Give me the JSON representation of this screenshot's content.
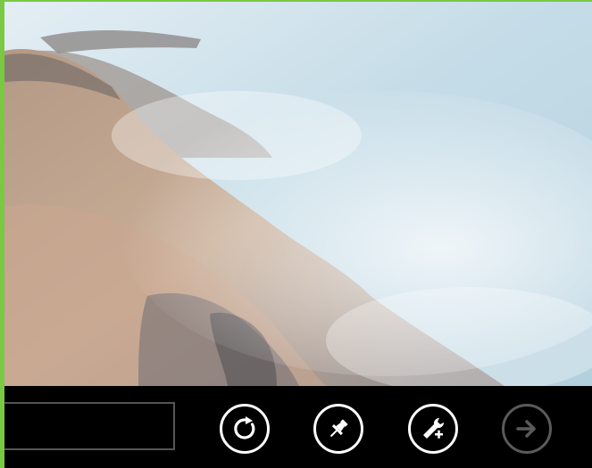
{
  "browser": {
    "address_bar": {
      "value": "",
      "placeholder": ""
    },
    "buttons": [
      {
        "name": "refresh",
        "icon": "refresh-icon",
        "enabled": true
      },
      {
        "name": "pin",
        "icon": "pin-icon",
        "enabled": true
      },
      {
        "name": "page-tools",
        "icon": "wrench-plus-icon",
        "enabled": true
      },
      {
        "name": "forward",
        "icon": "arrow-right-icon",
        "enabled": false
      }
    ]
  },
  "colors": {
    "frame_accent": "#7ac943",
    "app_bar": "#000000",
    "button_enabled": "#ffffff",
    "button_disabled": "#5a5a5a"
  }
}
